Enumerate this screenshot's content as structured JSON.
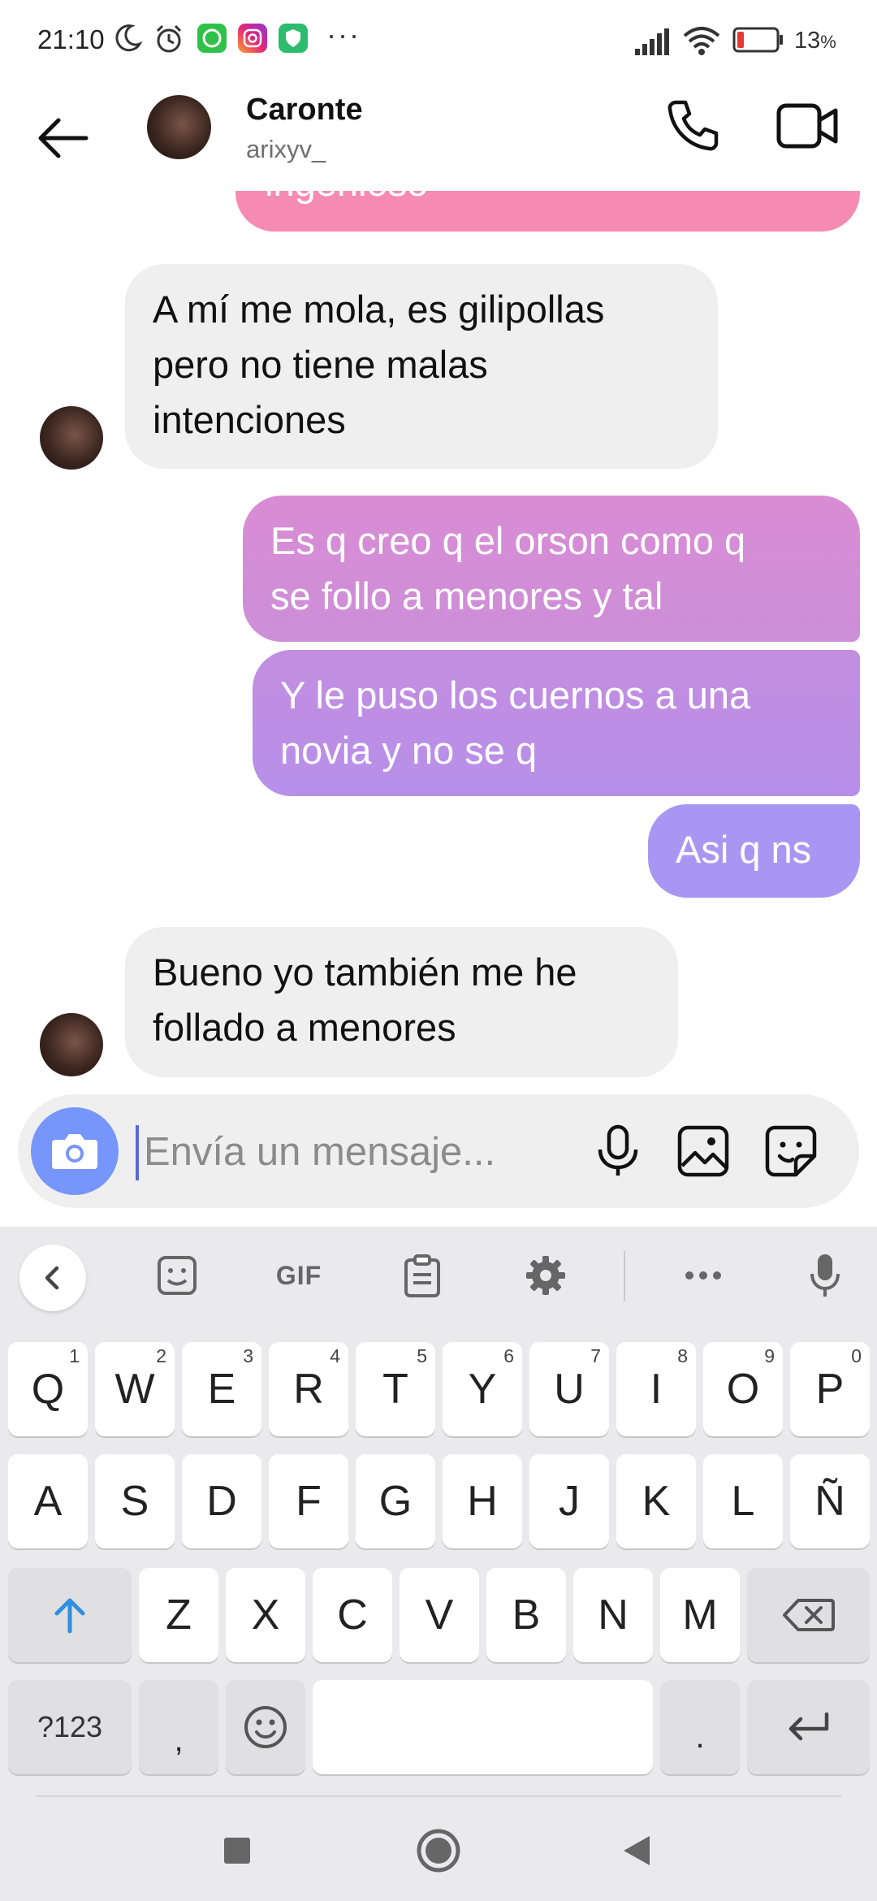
{
  "status_bar": {
    "time": "21:10",
    "battery": "13",
    "battery_unit": "%",
    "more": "···",
    "icons": [
      "moon-icon",
      "alarm-icon",
      "whatsapp-icon",
      "instagram-icon",
      "vpn-shield-icon",
      "signal-icon",
      "wifi-icon",
      "battery-icon"
    ]
  },
  "header": {
    "name": "Caronte",
    "username": "arixyv_"
  },
  "messages": {
    "partial_top": "ingenioso",
    "m1_lines": [
      "A mí me mola, es gilipollas",
      "pero no tiene malas",
      "intenciones"
    ],
    "m2_lines": [
      "Es q creo q el orson como q",
      "se follo a menores y tal"
    ],
    "m3_lines": [
      "Y le puso los cuernos a una",
      "novia y no se q"
    ],
    "m4": "Asi q ns",
    "m5_lines": [
      "Bueno yo también me he",
      "follado a menores"
    ]
  },
  "composer": {
    "placeholder": "Envía un mensaje..."
  },
  "keyboard": {
    "toolbar": {
      "gif": "GIF"
    },
    "row1": [
      {
        "k": "Q",
        "n": "1"
      },
      {
        "k": "W",
        "n": "2"
      },
      {
        "k": "E",
        "n": "3"
      },
      {
        "k": "R",
        "n": "4"
      },
      {
        "k": "T",
        "n": "5"
      },
      {
        "k": "Y",
        "n": "6"
      },
      {
        "k": "U",
        "n": "7"
      },
      {
        "k": "I",
        "n": "8"
      },
      {
        "k": "O",
        "n": "9"
      },
      {
        "k": "P",
        "n": "0"
      }
    ],
    "row2": [
      "A",
      "S",
      "D",
      "F",
      "G",
      "H",
      "J",
      "K",
      "L",
      "Ñ"
    ],
    "row3": [
      "Z",
      "X",
      "C",
      "V",
      "B",
      "N",
      "M"
    ],
    "symbols": "?123",
    "comma": ",",
    "period": "."
  },
  "colors": {
    "accent_camera": "#7796fb",
    "outgoing_pink": "#f58bb0",
    "outgoing_purple": "#a897f2",
    "incoming_grey": "#efefef"
  }
}
